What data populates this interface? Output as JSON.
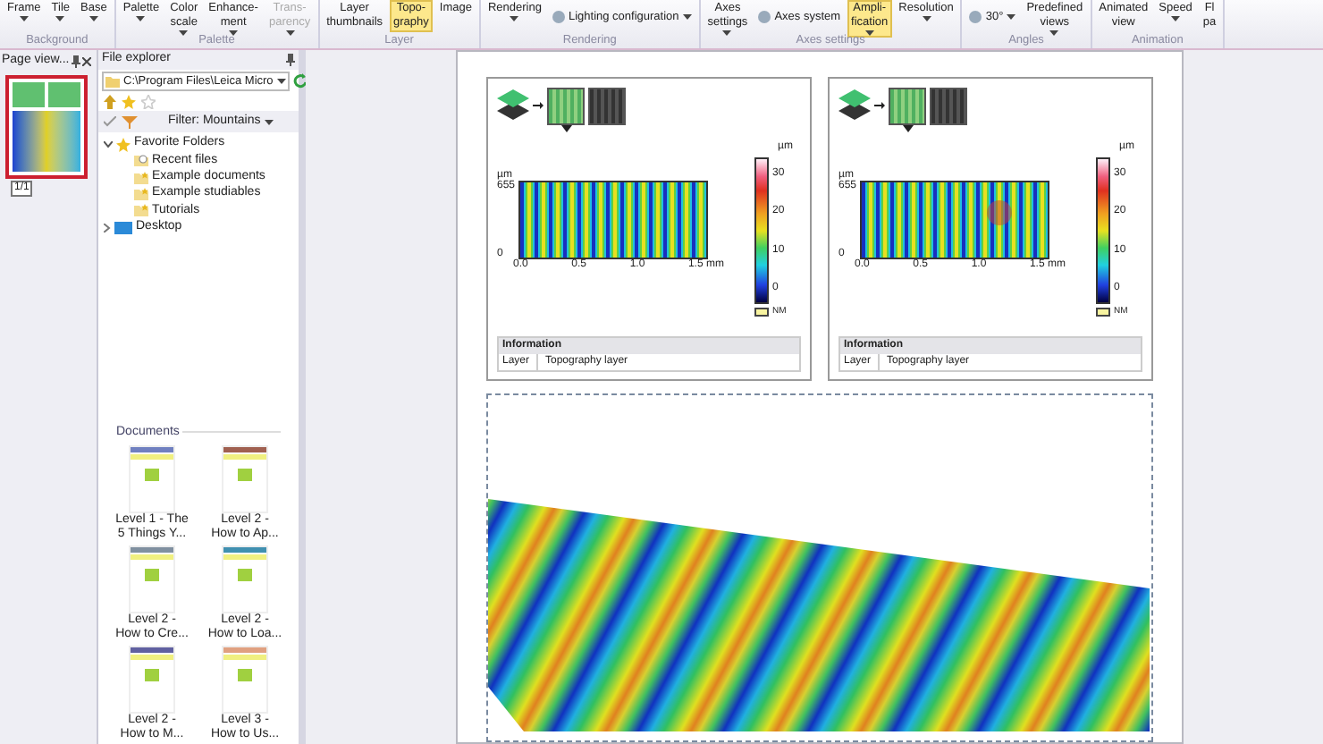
{
  "ribbon": {
    "groups": [
      {
        "label": "Background",
        "buttons": [
          {
            "lines": [
              "Frame"
            ],
            "dropdown": true,
            "selected": false,
            "disabled": false
          },
          {
            "lines": [
              "Tile"
            ],
            "dropdown": true,
            "selected": false,
            "disabled": false
          },
          {
            "lines": [
              "Base"
            ],
            "dropdown": true,
            "selected": false,
            "disabled": false
          }
        ]
      },
      {
        "label": "Palette",
        "buttons": [
          {
            "lines": [
              "Palette"
            ],
            "dropdown": true,
            "selected": false,
            "disabled": false
          },
          {
            "lines": [
              "Color",
              "scale"
            ],
            "dropdown": true,
            "selected": false,
            "disabled": false
          },
          {
            "lines": [
              "Enhance-",
              "ment"
            ],
            "dropdown": true,
            "selected": false,
            "disabled": false
          },
          {
            "lines": [
              "Trans-",
              "parency"
            ],
            "dropdown": true,
            "selected": false,
            "disabled": true
          }
        ]
      },
      {
        "label": "Layer",
        "buttons": [
          {
            "lines": [
              "Layer",
              "thumbnails"
            ],
            "dropdown": false,
            "selected": false,
            "disabled": false
          },
          {
            "lines": [
              "Topo-",
              "graphy"
            ],
            "dropdown": false,
            "selected": true,
            "disabled": false
          },
          {
            "lines": [
              "Image"
            ],
            "dropdown": false,
            "selected": false,
            "disabled": false
          }
        ]
      },
      {
        "label": "Rendering",
        "buttons": [
          {
            "lines": [
              "Rendering"
            ],
            "dropdown": true,
            "selected": false,
            "disabled": false
          },
          {
            "lines": [
              "Lighting configuration"
            ],
            "dropdown": true,
            "selected": false,
            "disabled": false,
            "kind": "inline"
          }
        ]
      },
      {
        "label": "Axes settings",
        "buttons": [
          {
            "lines": [
              "Axes",
              "settings"
            ],
            "dropdown": true,
            "selected": false,
            "disabled": false
          },
          {
            "lines": [
              "Axes system"
            ],
            "dropdown": false,
            "selected": false,
            "disabled": false,
            "kind": "inline"
          },
          {
            "lines": [
              "Ampli-",
              "fication"
            ],
            "dropdown": true,
            "selected": true,
            "disabled": false
          },
          {
            "lines": [
              "Resolution"
            ],
            "dropdown": true,
            "selected": false,
            "disabled": false
          }
        ]
      },
      {
        "label": "Angles",
        "buttons": [
          {
            "lines": [
              "30°"
            ],
            "dropdown": true,
            "selected": false,
            "disabled": false,
            "kind": "inline"
          },
          {
            "lines": [
              "Predefined",
              "views"
            ],
            "dropdown": true,
            "selected": false,
            "disabled": false
          }
        ]
      },
      {
        "label": "Animation",
        "buttons": [
          {
            "lines": [
              "Animated",
              "view"
            ],
            "dropdown": false,
            "selected": false,
            "disabled": false
          },
          {
            "lines": [
              "Speed"
            ],
            "dropdown": true,
            "selected": false,
            "disabled": false
          },
          {
            "lines": [
              "Fl",
              "pa"
            ],
            "dropdown": false,
            "selected": false,
            "disabled": false
          }
        ]
      }
    ]
  },
  "page_view": {
    "title": "Page view...",
    "page_count": "1/1"
  },
  "file_explorer": {
    "title": "File explorer",
    "path": "C:\\Program Files\\Leica Micro",
    "filter": "Filter: Mountains",
    "tree": [
      {
        "label": "Favorite Folders",
        "kind": "favorites",
        "expanded": true,
        "children": [
          {
            "label": "Recent files",
            "kind": "recent"
          },
          {
            "label": "Example documents",
            "kind": "folder"
          },
          {
            "label": "Example studiables",
            "kind": "folder"
          },
          {
            "label": "Tutorials",
            "kind": "folder"
          }
        ]
      },
      {
        "label": "Desktop",
        "kind": "desktop",
        "expanded": false
      }
    ],
    "documents_title": "Documents",
    "documents": [
      {
        "lines": [
          "Level 1 - The",
          "5 Things Y..."
        ]
      },
      {
        "lines": [
          "Level 2 -",
          "How to Ap..."
        ]
      },
      {
        "lines": [
          "Level 2 -",
          "How to Cre..."
        ]
      },
      {
        "lines": [
          "Level 2 -",
          "How to Loa..."
        ]
      },
      {
        "lines": [
          "Level 2 -",
          "How to M..."
        ]
      },
      {
        "lines": [
          "Level 3 -",
          "How to Us..."
        ]
      }
    ]
  },
  "cards": [
    {
      "y_unit": "µm",
      "y_ticks": [
        "655",
        "0"
      ],
      "x_ticks": [
        "0.0",
        "0.5",
        "1.0",
        "1.5 mm"
      ],
      "scale_unit": "µm",
      "scale_ticks": [
        "30",
        "20",
        "10",
        "0"
      ],
      "legend": "NM",
      "info_header": "Information",
      "info_rows": [
        {
          "label": "Layer",
          "value": "Topography layer"
        }
      ]
    },
    {
      "y_unit": "µm",
      "y_ticks": [
        "655",
        "0"
      ],
      "x_ticks": [
        "0.0",
        "0.5",
        "1.0",
        "1.5 mm"
      ],
      "scale_unit": "µm",
      "scale_ticks": [
        "30",
        "20",
        "10",
        "0"
      ],
      "legend": "NM",
      "info_header": "Information",
      "info_rows": [
        {
          "label": "Layer",
          "value": "Topography layer"
        }
      ]
    }
  ]
}
